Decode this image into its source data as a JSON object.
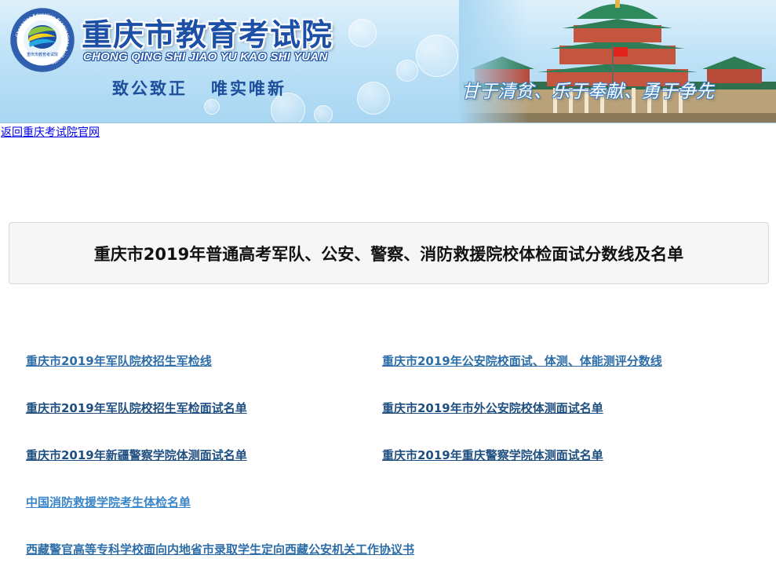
{
  "banner": {
    "title": "重庆市教育考试院",
    "pinyin": "CHONG QING SHI JIAO YU KAO SHI YUAN",
    "motto_left": "致公致正",
    "motto_right": "唯实唯新",
    "slogan": "甘于清贫、乐于奉献、勇于争先",
    "logo_ring_text": "Chongqing Education Examinations Authority",
    "logo_inner_text": "重庆市教育考试院",
    "logo_icon": "ceea-logo-icon",
    "building_image": "great-hall-image"
  },
  "nav": {
    "back_label": "返回重庆考试院官网"
  },
  "main": {
    "title": "重庆市2019年普通高考军队、公安、警察、消防救援院校体检面试分数线及名单",
    "links": [
      "重庆市2019年军队院校招生军检线",
      "重庆市2019年公安院校面试、体测、体能测评分数线",
      "重庆市2019年军队院校招生军检面试名单",
      "重庆市2019年市外公安院校体测面试名单",
      "重庆市2019年新疆警察学院体测面试名单",
      "重庆市2019年重庆警察学院体测面试名单",
      "中国消防救援学院考生体检名单",
      "西藏警官高等专科学校面向内地省市录取学生定向西藏公安机关工作协议书"
    ]
  },
  "colors": {
    "banner_blue": "#1c4fa6",
    "link_blue": "#2e6ea8",
    "back_link": "#0000ee",
    "title_box_bg": "#f6f6f6"
  }
}
